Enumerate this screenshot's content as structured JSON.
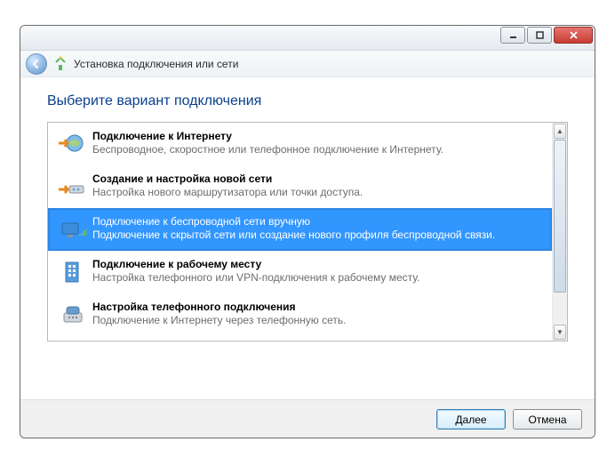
{
  "window": {
    "title": "Установка подключения или сети",
    "main_title": "Выберите вариант подключения"
  },
  "options": [
    {
      "title": "Подключение к Интернету",
      "desc": "Беспроводное, скоростное или телефонное подключение к Интернету."
    },
    {
      "title": "Создание и настройка новой сети",
      "desc": "Настройка нового маршрутизатора или точки доступа."
    },
    {
      "title": "Подключение к беспроводной сети вручную",
      "desc": "Подключение к скрытой сети или создание нового профиля беспроводной связи."
    },
    {
      "title": "Подключение к рабочему месту",
      "desc": "Настройка телефонного или VPN-подключения к рабочему месту."
    },
    {
      "title": "Настройка телефонного подключения",
      "desc": "Подключение к Интернету через телефонную сеть."
    }
  ],
  "selected_index": 2,
  "buttons": {
    "next": "Далее",
    "cancel": "Отмена"
  }
}
